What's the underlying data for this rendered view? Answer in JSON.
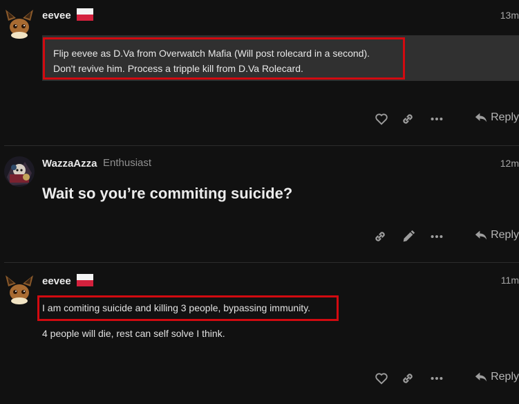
{
  "posts": [
    {
      "username": "eevee",
      "time": "13m",
      "quote_lines": [
        "Flip eevee as D.Va from Overwatch Mafia (Will post rolecard in a second).",
        "Don't revive him. Process a tripple kill from D.Va Rolecard."
      ],
      "reply_label": "Reply"
    },
    {
      "username": "WazzaAzza",
      "user_title": "Enthusiast",
      "time": "12m",
      "heading": "Wait so you’re commiting suicide?",
      "reply_label": "Reply"
    },
    {
      "username": "eevee",
      "time": "11m",
      "lines": [
        "I am comiting suicide and killing 3 people, bypassing immunity.",
        "4 people will die, rest can self solve I think."
      ],
      "reply_label": "Reply"
    }
  ],
  "colors": {
    "background": "#111111",
    "highlight_box": "#d20a10",
    "quote_bg": "#303030",
    "flag_white": "#f4f4f4",
    "flag_red": "#d4213d"
  },
  "icons": [
    "eevee-avatar",
    "wazza-avatar",
    "flag-icon",
    "heart-icon",
    "link-icon",
    "edit-icon",
    "more-icon",
    "reply-icon"
  ]
}
